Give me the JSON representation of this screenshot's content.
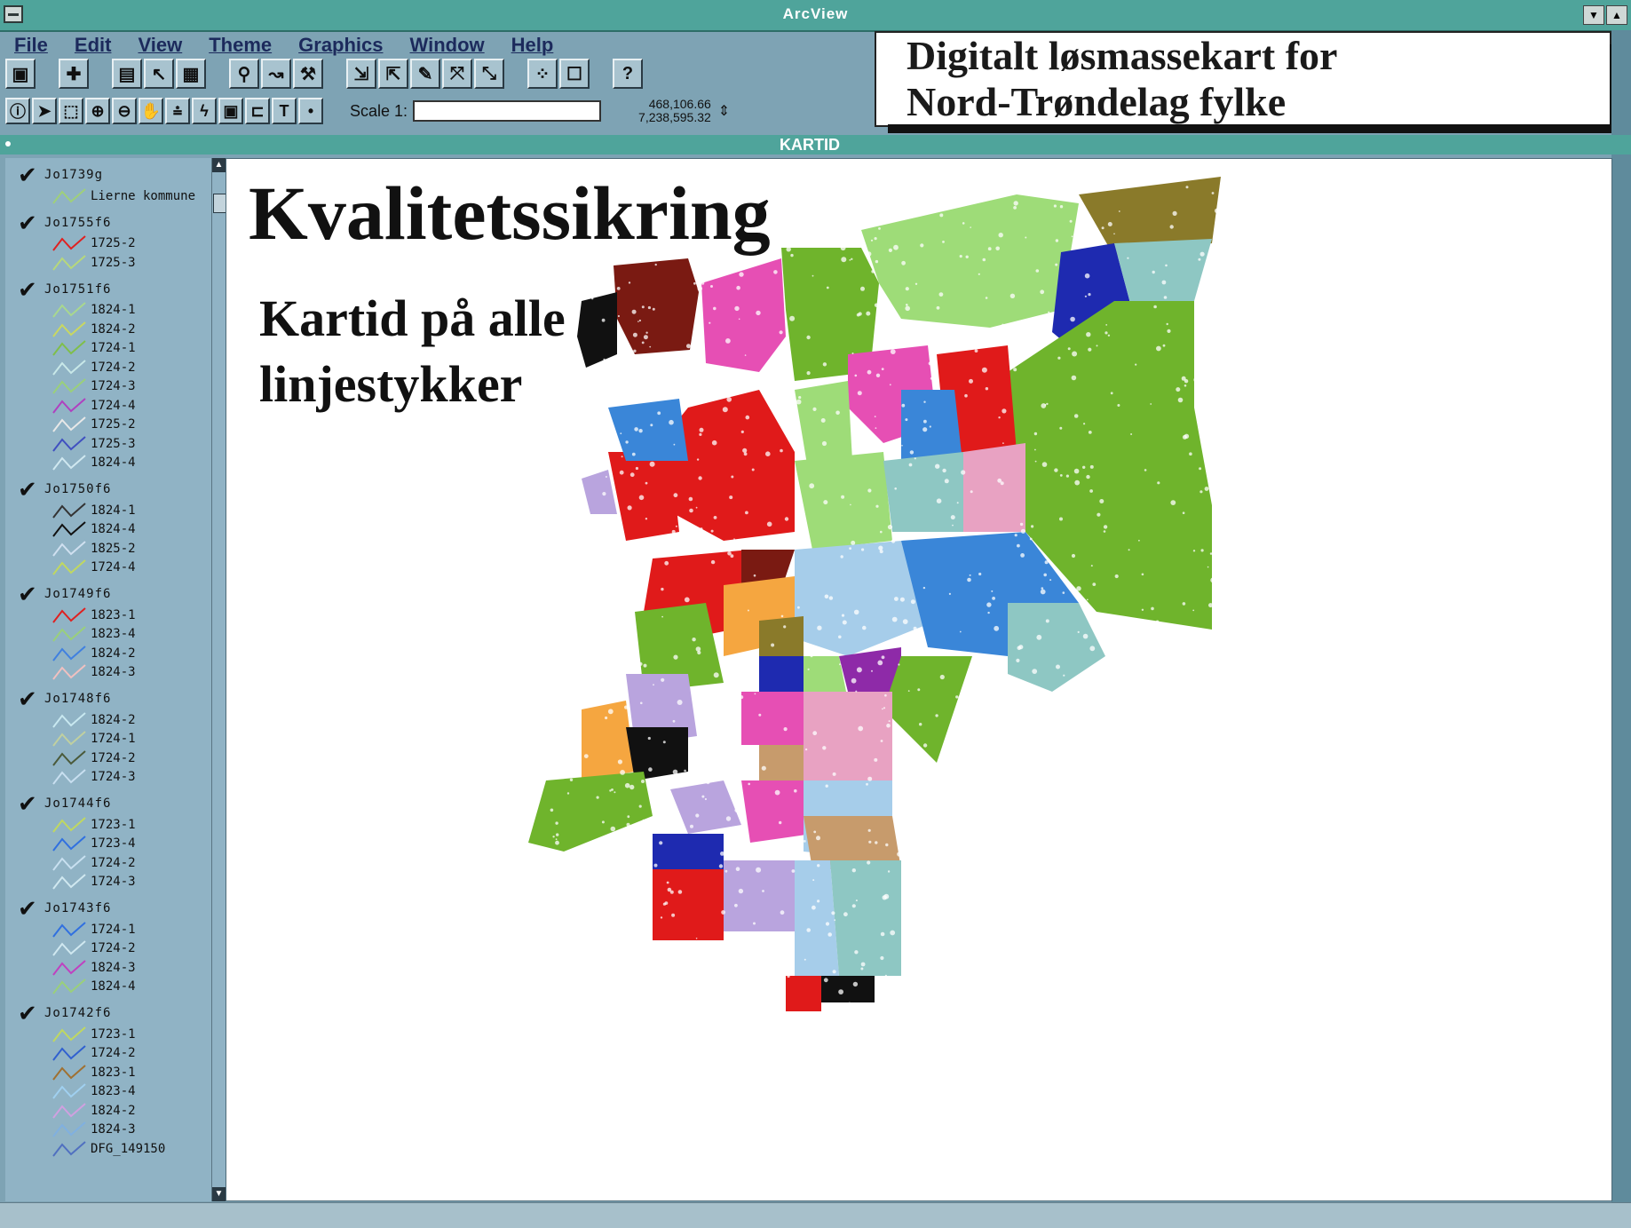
{
  "window": {
    "title": "ArcView"
  },
  "menu": [
    {
      "label": "File"
    },
    {
      "label": "Edit"
    },
    {
      "label": "View"
    },
    {
      "label": "Theme"
    },
    {
      "label": "Graphics"
    },
    {
      "label": "Window"
    },
    {
      "label": "Help"
    }
  ],
  "toolbar": {
    "scale_label": "Scale 1:",
    "scale_value": "",
    "coord_x": "468,106.66",
    "coord_y": "7,238,595.32"
  },
  "caption": {
    "line1": "Digitalt løsmassekart for",
    "line2": "Nord-Trøndelag fylke"
  },
  "view": {
    "title": "KARTID"
  },
  "overlay": {
    "title": "Kvalitetssikring",
    "subtitle_line1": "Kartid på alle",
    "subtitle_line2": "linjestykker"
  },
  "themes": [
    {
      "name": "Jo1739g",
      "entries": [
        {
          "label": "Lierne kommune",
          "color": "#9fd07a"
        }
      ]
    },
    {
      "name": "Jo1755f6",
      "entries": [
        {
          "label": "1725-2",
          "color": "#e02020"
        },
        {
          "label": "1725-3",
          "color": "#b7d87a"
        }
      ]
    },
    {
      "name": "Jo1751f6",
      "entries": [
        {
          "label": "1824-1",
          "color": "#a9d88e"
        },
        {
          "label": "1824-2",
          "color": "#c9d860"
        },
        {
          "label": "1724-1",
          "color": "#7fbf4a"
        },
        {
          "label": "1724-2",
          "color": "#c8e8e8"
        },
        {
          "label": "1724-3",
          "color": "#9ad07a"
        },
        {
          "label": "1724-4",
          "color": "#b040c0"
        },
        {
          "label": "1725-2",
          "color": "#e8e8e8"
        },
        {
          "label": "1725-3",
          "color": "#4050c0"
        },
        {
          "label": "1824-4",
          "color": "#d0e8f0"
        }
      ]
    },
    {
      "name": "Jo1750f6",
      "entries": [
        {
          "label": "1824-1",
          "color": "#333333"
        },
        {
          "label": "1824-4",
          "color": "#111111"
        },
        {
          "label": "1825-2",
          "color": "#d0e0f0"
        },
        {
          "label": "1724-4",
          "color": "#c0d860"
        }
      ]
    },
    {
      "name": "Jo1749f6",
      "entries": [
        {
          "label": "1823-1",
          "color": "#e02020"
        },
        {
          "label": "1823-4",
          "color": "#9ad07a"
        },
        {
          "label": "1824-2",
          "color": "#4080e0"
        },
        {
          "label": "1824-3",
          "color": "#f0c0c0"
        }
      ]
    },
    {
      "name": "Jo1748f6",
      "entries": [
        {
          "label": "1824-2",
          "color": "#c8e8f0"
        },
        {
          "label": "1724-1",
          "color": "#c0d0a0"
        },
        {
          "label": "1724-2",
          "color": "#4a5a3a"
        },
        {
          "label": "1724-3",
          "color": "#c8dff0"
        }
      ]
    },
    {
      "name": "Jo1744f6",
      "entries": [
        {
          "label": "1723-1",
          "color": "#c0d860"
        },
        {
          "label": "1723-4",
          "color": "#3070e0"
        },
        {
          "label": "1724-2",
          "color": "#c8e0f0"
        },
        {
          "label": "1724-3",
          "color": "#d0e8f0"
        }
      ]
    },
    {
      "name": "Jo1743f6",
      "entries": [
        {
          "label": "1724-1",
          "color": "#3070e0"
        },
        {
          "label": "1724-2",
          "color": "#d0e8f0"
        },
        {
          "label": "1824-3",
          "color": "#c040c0"
        },
        {
          "label": "1824-4",
          "color": "#9ad07a"
        }
      ]
    },
    {
      "name": "Jo1742f6",
      "entries": [
        {
          "label": "1723-1",
          "color": "#c0d860"
        },
        {
          "label": "1724-2",
          "color": "#3060d0"
        },
        {
          "label": "1823-1",
          "color": "#a07030"
        },
        {
          "label": "1823-4",
          "color": "#a0d0f0"
        },
        {
          "label": "1824-2",
          "color": "#d0a0e0"
        },
        {
          "label": "1824-3",
          "color": "#80b0e0"
        },
        {
          "label": "DFG_149150",
          "color": "#5070c0"
        }
      ]
    }
  ],
  "map_colors": {
    "green": "#6fb42c",
    "red": "#e01a1a",
    "blue": "#3a86d8",
    "pink": "#e64fb4",
    "lightblue": "#a6cdea",
    "darkblue": "#1e2ab0",
    "brown": "#7a1a12",
    "black": "#111111",
    "olive": "#8a7a2a",
    "lightgreen": "#9edc78",
    "lavender": "#b9a4de",
    "orange": "#f5a640",
    "teal": "#8ec7c3",
    "tan": "#c79b6c",
    "purple": "#8e2aa8",
    "rose": "#e8a2c2"
  }
}
